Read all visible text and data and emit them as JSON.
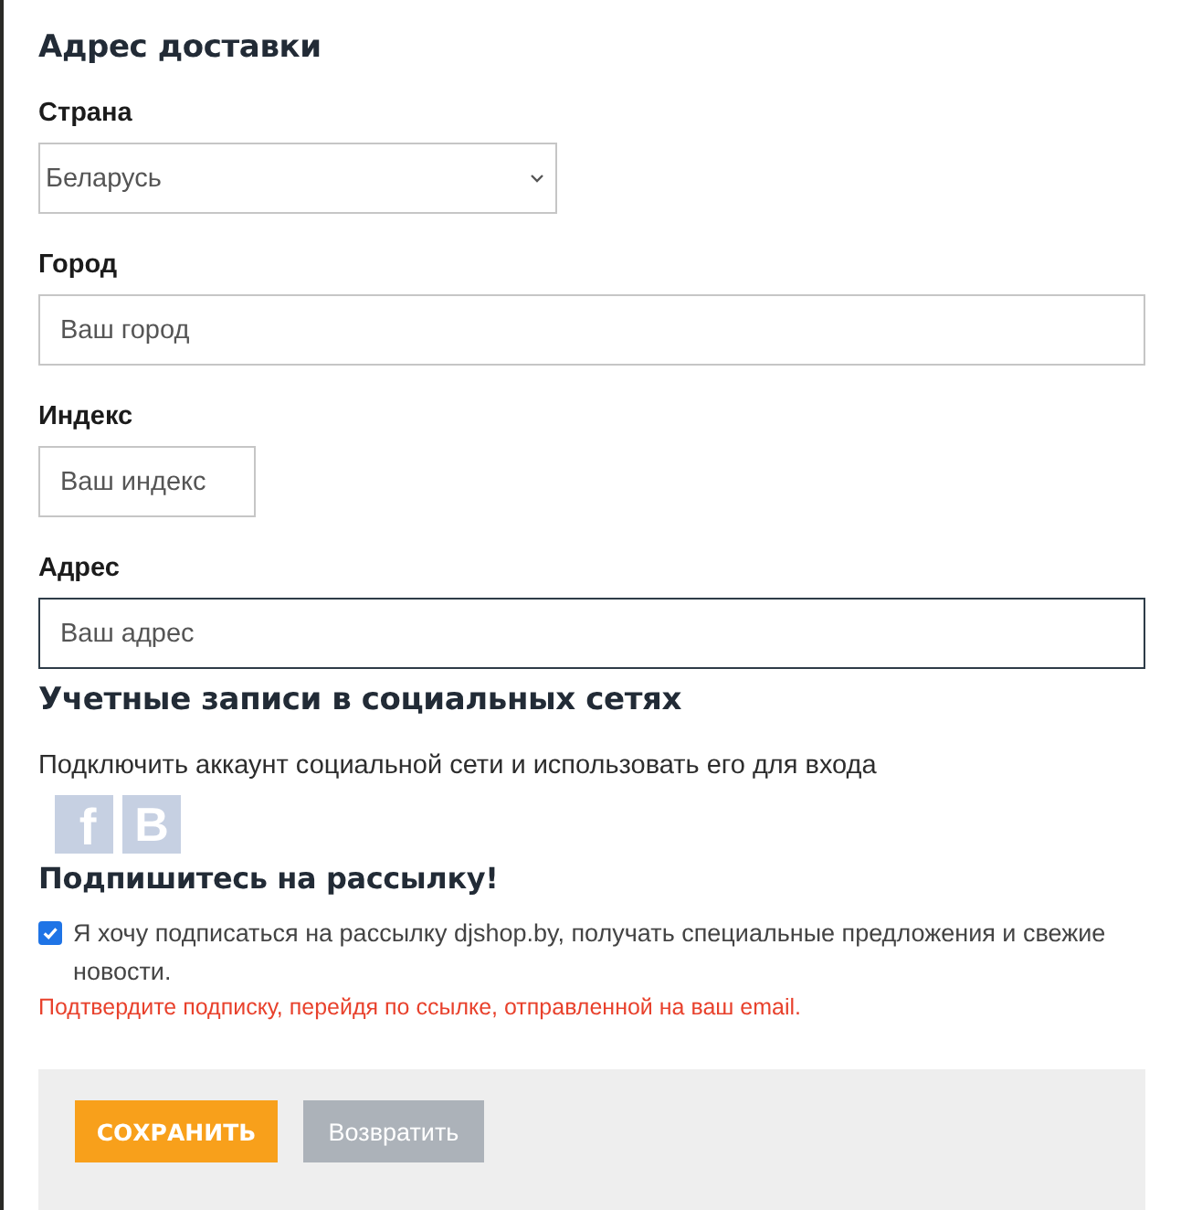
{
  "delivery": {
    "title": "Адрес доставки",
    "fields": [
      {
        "label": "Страна",
        "kind": "select",
        "value": "Беларусь",
        "focused": false
      },
      {
        "label": "Город",
        "kind": "text",
        "placeholder": "Ваш город",
        "focused": false
      },
      {
        "label": "Индекс",
        "kind": "text",
        "placeholder": "Ваш индекс",
        "focused": false
      },
      {
        "label": "Адрес",
        "kind": "text",
        "placeholder": "Ваш адрес",
        "focused": true
      }
    ]
  },
  "social": {
    "title": "Учетные записи в социальных сетях",
    "description": "Подключить аккаунт социальной сети и использовать его для входа",
    "accounts": [
      {
        "glyph": "f",
        "kind": "fb"
      },
      {
        "glyph": "B",
        "kind": "vk"
      }
    ]
  },
  "subscribe": {
    "title": "Подпишитесь на рассылку!",
    "checked": true,
    "label": "Я хочу подписаться на рассылку djshop.by, получать специальные предложения и свежие новости.",
    "note": "Подтвердите подписку, перейдя по ссылке, отправленной на ваш email."
  },
  "buttons": [
    {
      "label": "СОХРАНИТЬ",
      "kind": "primary"
    },
    {
      "label": "Возвратить",
      "kind": "secondary"
    }
  ]
}
